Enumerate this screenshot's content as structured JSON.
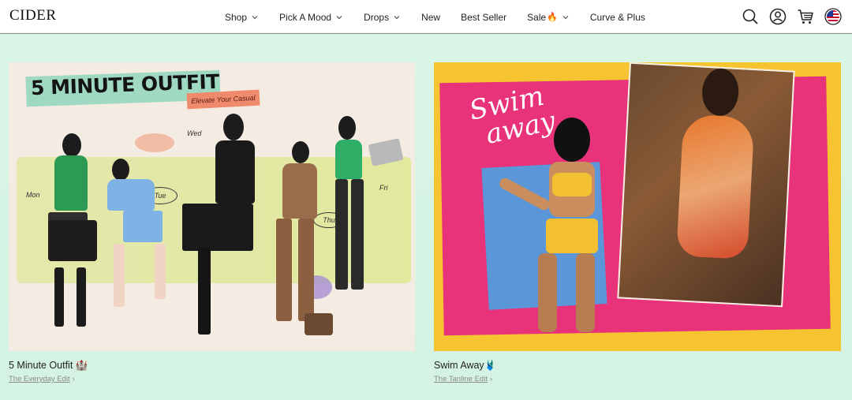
{
  "brand": {
    "logo": "CIDER"
  },
  "nav": {
    "items": [
      {
        "label": "Shop",
        "has_dropdown": true
      },
      {
        "label": "Pick A Mood",
        "has_dropdown": true
      },
      {
        "label": "Drops",
        "has_dropdown": true
      },
      {
        "label": "New",
        "has_dropdown": false
      },
      {
        "label": "Best Seller",
        "has_dropdown": false
      },
      {
        "label": "Sale",
        "emoji": "🔥",
        "has_dropdown": true
      },
      {
        "label": "Curve & Plus",
        "has_dropdown": false
      }
    ]
  },
  "header_icons": [
    "search-icon",
    "account-icon",
    "cart-icon",
    "us-flag-icon"
  ],
  "cards": [
    {
      "title": "5 Minute Outfit 🏰",
      "link": "The Everyday Edit",
      "image": {
        "headline": "5 MINUTE OUTFIT",
        "tag": "Elevate Your Casual",
        "notes": {
          "mon": "Mon",
          "tue": "Tue",
          "wed": "Wed",
          "thu": "Thu",
          "fri": "Fri"
        }
      }
    },
    {
      "title": "Swim Away🩱",
      "link": "The Tanline Edit",
      "image": {
        "script_line1": "Swim",
        "script_line2": "away"
      }
    }
  ],
  "colors": {
    "page_bg": "#d9f5e7",
    "header_bg": "#ffffff",
    "swim_yellow": "#f7c431",
    "swim_pink": "#e8327a",
    "outfit_bg": "#f4ece2",
    "outfit_banner": "#9fd9c2",
    "outfit_tag": "#ef8a6c"
  }
}
